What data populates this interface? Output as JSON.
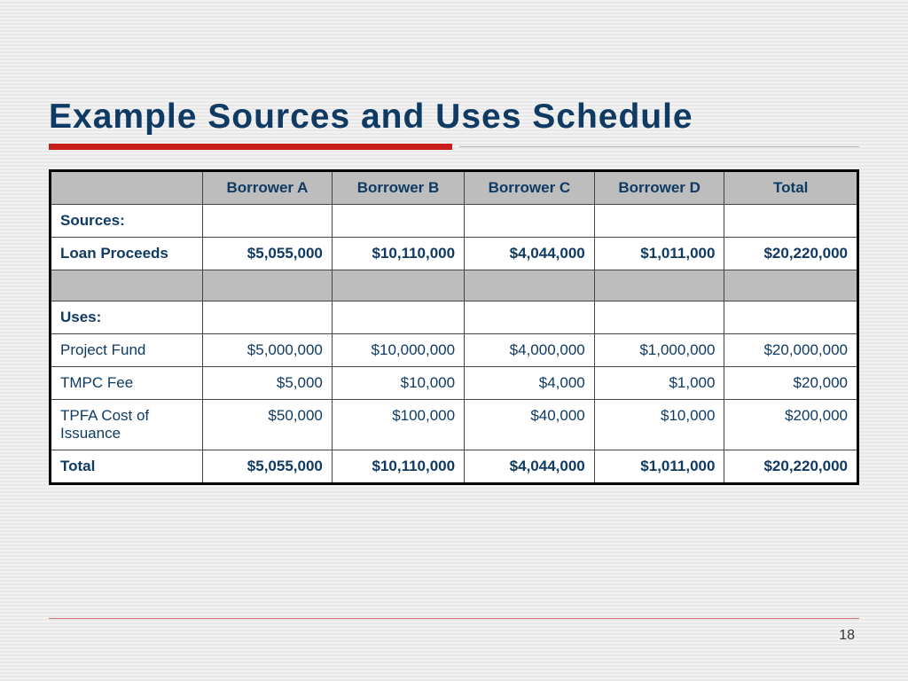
{
  "title": "Example Sources and Uses Schedule",
  "page_number": "18",
  "columns": [
    "Borrower A",
    "Borrower B",
    "Borrower C",
    "Borrower D",
    "Total"
  ],
  "sections": {
    "sources_label": "Sources:",
    "uses_label": "Uses:",
    "total_label": "Total"
  },
  "rows": {
    "loan_proceeds": {
      "label": "Loan Proceeds",
      "a": "$5,055,000",
      "b": "$10,110,000",
      "c": "$4,044,000",
      "d": "$1,011,000",
      "t": "$20,220,000"
    },
    "project_fund": {
      "label": "Project Fund",
      "a": "$5,000,000",
      "b": "$10,000,000",
      "c": "$4,000,000",
      "d": "$1,000,000",
      "t": "$20,000,000"
    },
    "tmpc_fee": {
      "label": "TMPC Fee",
      "a": "$5,000",
      "b": "$10,000",
      "c": "$4,000",
      "d": "$1,000",
      "t": "$20,000"
    },
    "tpfa_cost": {
      "label": "TPFA Cost of Issuance",
      "a": "$50,000",
      "b": "$100,000",
      "c": "$40,000",
      "d": "$10,000",
      "t": "$200,000"
    },
    "total": {
      "a": "$5,055,000",
      "b": "$10,110,000",
      "c": "$4,044,000",
      "d": "$1,011,000",
      "t": "$20,220,000"
    }
  },
  "chart_data": {
    "type": "table",
    "title": "Example Sources and Uses Schedule",
    "columns": [
      "",
      "Borrower A",
      "Borrower B",
      "Borrower C",
      "Borrower D",
      "Total"
    ],
    "rows": [
      [
        "Sources:",
        "",
        "",
        "",
        "",
        ""
      ],
      [
        "Loan Proceeds",
        5055000,
        10110000,
        4044000,
        1011000,
        20220000
      ],
      [
        "Uses:",
        "",
        "",
        "",
        "",
        ""
      ],
      [
        "Project Fund",
        5000000,
        10000000,
        4000000,
        1000000,
        20000000
      ],
      [
        "TMPC Fee",
        5000,
        10000,
        4000,
        1000,
        20000
      ],
      [
        "TPFA Cost of Issuance",
        50000,
        100000,
        40000,
        10000,
        200000
      ],
      [
        "Total",
        5055000,
        10110000,
        4044000,
        1011000,
        20220000
      ]
    ]
  }
}
